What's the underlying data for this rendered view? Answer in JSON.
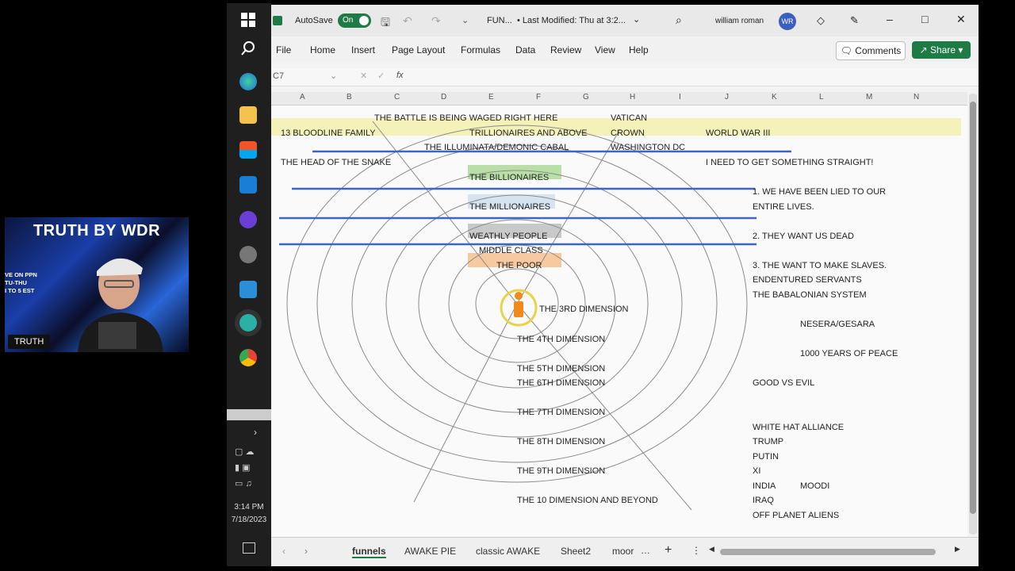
{
  "webcam": {
    "title": "TRUTH BY WDR",
    "side_text": [
      "VE ON PPN",
      "TU-THU",
      "I TO 5 EST"
    ],
    "name_tag": "TRUTH"
  },
  "taskbar": {
    "time": "3:14 PM",
    "date": "7/18/2023"
  },
  "titlebar": {
    "autosave_label": "AutoSave",
    "autosave_state": "On",
    "file_name": "FUN...",
    "last_modified": "• Last Modified: Thu at 3:2...",
    "user_name": "william roman",
    "user_initials": "WR"
  },
  "menu": {
    "items": [
      "File",
      "Home",
      "Insert",
      "Page Layout",
      "Formulas",
      "Data",
      "Review",
      "View",
      "Help"
    ],
    "comments_label": "Comments",
    "share_label": "Share"
  },
  "formula_bar": {
    "name_box": "C7",
    "fx": "fx",
    "value": ""
  },
  "columns": [
    "A",
    "B",
    "C",
    "D",
    "E",
    "F",
    "G",
    "H",
    "I",
    "J",
    "K",
    "L",
    "M",
    "N"
  ],
  "cells": {
    "battle": "THE BATTLE IS BEING WAGED RIGHT HERE",
    "vatican": "VATICAN",
    "bloodline": "13 BLOODLINE FAMILY",
    "trillionaires": "TRILLIONAIRES AND ABOVE",
    "crown": "CROWN",
    "ww3": "WORLD WAR III",
    "illuminata": "THE ILLUMINATA/DEMONIC CABAL",
    "washington": "WASHINGTON DC",
    "head": "THE HEAD OF THE SNAKE",
    "straight": "I NEED TO GET SOMETHING STRAIGHT!",
    "billionaires": "THE BILLIONAIRES",
    "lied1": "1. WE HAVE BEEN LIED TO OUR",
    "lied2": "ENTIRE LIVES.",
    "millionaires": "THE MILLIONAIRES",
    "wealthy": "WEATHLY PEOPLE",
    "dead": "2. THEY WANT US DEAD",
    "middle": "MIDDLE CLASS",
    "poor": "THE POOR",
    "slaves": "3. THE WANT TO MAKE SLAVES.",
    "servants": "ENDENTURED SERVANTS",
    "babalonian": "THE BABALONIAN SYSTEM",
    "dim3": "THE 3RD DIMENSION",
    "nesera": "NESERA/GESARA",
    "dim4": "THE 4TH DIMENSION",
    "peace": "1000 YEARS OF PEACE",
    "dim5": "THE 5TH DIMENSION",
    "dim6": "THE 6TH DIMENSION",
    "good": "GOOD VS EVIL",
    "dim7": "THE 7TH DIMENSION",
    "white_hat": "WHITE HAT ALLIANCE",
    "dim8": "THE 8TH  DIMENSION",
    "trump": "TRUMP",
    "putin": "PUTIN",
    "dim9": "THE 9TH DIMENSION",
    "xi": "XI",
    "india": "INDIA",
    "moodi": "MOODI",
    "dim10": "THE 10 DIMENSION AND BEYOND",
    "iraq": "IRAQ",
    "aliens": "OFF PLANET ALIENS"
  },
  "sheets": {
    "tabs": [
      "funnels",
      "AWAKE PIE",
      "classic AWAKE",
      "Sheet2",
      "moor"
    ],
    "active": "funnels"
  },
  "colors": {
    "excel_green": "#1e7b45",
    "highlight_yellow": "#f4f2b8",
    "highlight_green": "#b8e0a6",
    "highlight_gray": "#c9c9c9",
    "highlight_orange": "#f6c9a0",
    "line_blue": "#3a67c2",
    "person_orange": "#f08a1a"
  }
}
